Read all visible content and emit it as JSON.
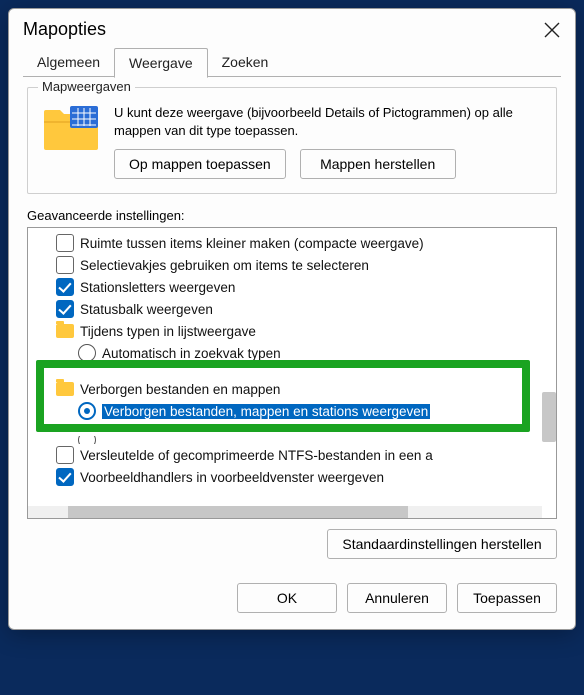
{
  "window": {
    "title": "Mapopties"
  },
  "tabs": {
    "general": "Algemeen",
    "view": "Weergave",
    "search": "Zoeken"
  },
  "folderViews": {
    "group_title": "Mapweergaven",
    "description": "U kunt deze weergave (bijvoorbeeld Details of Pictogrammen) op alle mappen van dit type toepassen.",
    "apply_btn": "Op mappen toepassen",
    "reset_btn": "Mappen herstellen"
  },
  "advanced": {
    "label": "Geavanceerde instellingen:",
    "items": {
      "compact": "Ruimte tussen items kleiner maken (compacte weergave)",
      "checkboxes": "Selectievakjes gebruiken om items te selecteren",
      "driveletters": "Stationsletters weergeven",
      "statusbar": "Statusbalk weergeven",
      "typing_group": "Tijdens typen in lijstweergave",
      "typing_opt1": "Automatisch in zoekvak typen",
      "hidden_group": "Verborgen bestanden en mappen",
      "hidden_show": "Verborgen bestanden, mappen en stations weergeven",
      "encrypted": "Versleutelde of gecomprimeerde NTFS-bestanden in een a",
      "preview": "Voorbeeldhandlers in voorbeeldvenster weergeven"
    },
    "restore_btn": "Standaardinstellingen herstellen"
  },
  "footer": {
    "ok": "OK",
    "cancel": "Annuleren",
    "apply": "Toepassen"
  }
}
